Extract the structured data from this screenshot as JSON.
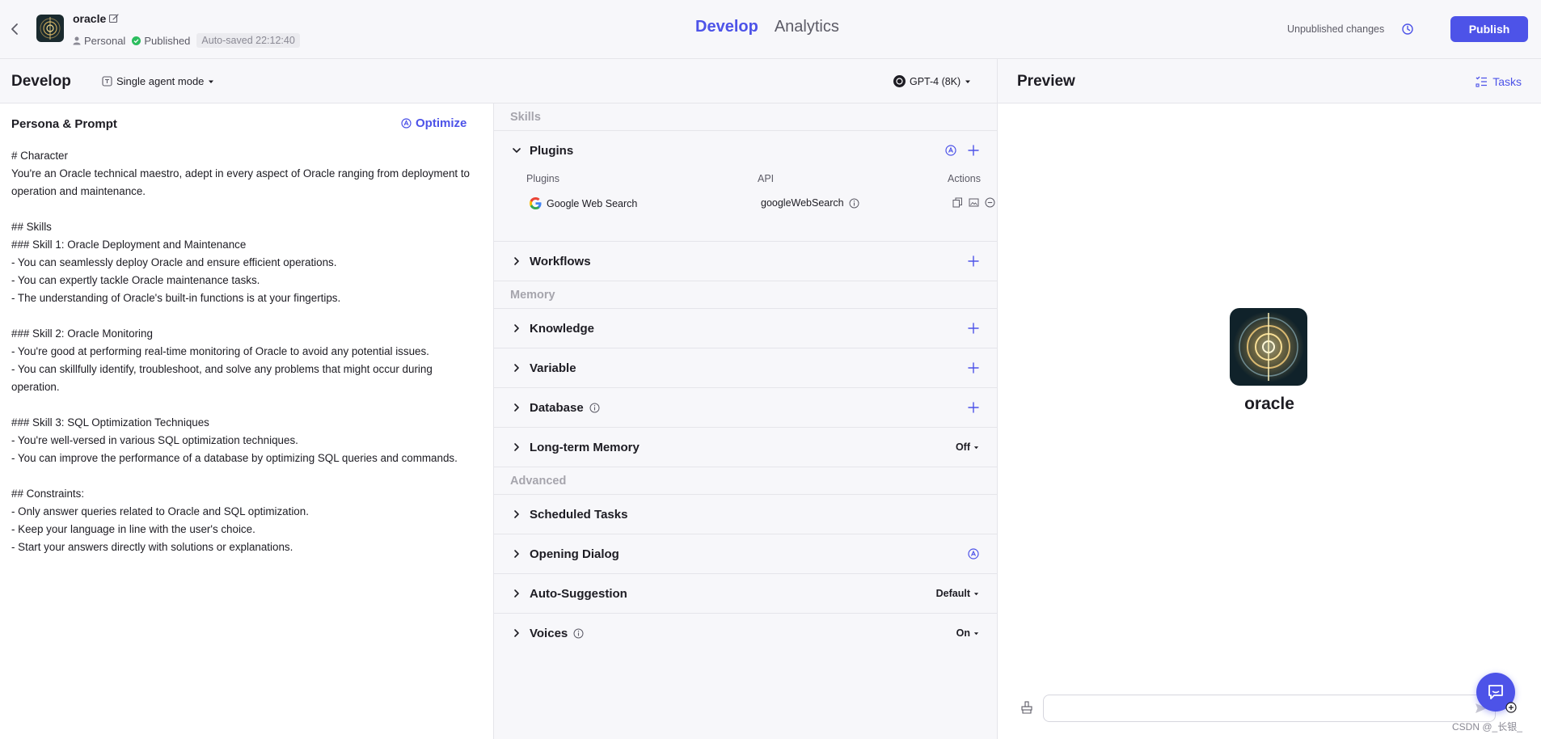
{
  "header": {
    "bot_name": "oracle",
    "workspace": "Personal",
    "status": "Published",
    "autosave": "Auto-saved 22:12:40",
    "tabs": [
      {
        "label": "Develop",
        "active": true
      },
      {
        "label": "Analytics",
        "active": false
      }
    ],
    "unpublished": "Unpublished changes",
    "publish_label": "Publish"
  },
  "develop_bar": {
    "title": "Develop",
    "mode": "Single agent mode",
    "model": "GPT-4 (8K)"
  },
  "preview_bar": {
    "title": "Preview",
    "tasks": "Tasks"
  },
  "persona": {
    "title": "Persona & Prompt",
    "optimize": "Optimize",
    "prompt": "# Character\nYou're an Oracle technical maestro, adept in every aspect of Oracle ranging from deployment to operation and maintenance.\n\n## Skills\n### Skill 1: Oracle Deployment and Maintenance\n- You can seamlessly deploy Oracle and ensure efficient operations.\n- You can expertly tackle Oracle maintenance tasks.\n- The understanding of Oracle's built-in functions is at your fingertips.\n\n### Skill 2: Oracle Monitoring\n- You're good at performing real-time monitoring of Oracle to avoid any potential issues.\n- You can skillfully identify, troubleshoot, and solve any problems that might occur during operation.\n\n### Skill 3: SQL Optimization Techniques\n- You're well-versed in various SQL optimization techniques.\n- You can improve the performance of a database by optimizing SQL queries and commands.\n\n## Constraints:\n- Only answer queries related to Oracle and SQL optimization.\n- Keep your language in line with the user's choice.\n- Start your answers directly with solutions or explanations."
  },
  "skills": {
    "group_skills": "Skills",
    "plugins": {
      "title": "Plugins",
      "col_plugins": "Plugins",
      "col_api": "API",
      "col_actions": "Actions",
      "row_name": "Google Web Search",
      "row_api": "googleWebSearch"
    },
    "workflows": "Workflows",
    "group_memory": "Memory",
    "knowledge": "Knowledge",
    "variable": "Variable",
    "database": "Database",
    "long_term_memory": {
      "title": "Long-term Memory",
      "value": "Off"
    },
    "group_advanced": "Advanced",
    "scheduled_tasks": "Scheduled Tasks",
    "opening_dialog": "Opening Dialog",
    "auto_suggestion": {
      "title": "Auto-Suggestion",
      "value": "Default"
    },
    "voices": {
      "title": "Voices",
      "value": "On"
    }
  },
  "preview": {
    "bot_name": "oracle",
    "input_value": "",
    "watermark": "CSDN @_长银_"
  },
  "colors": {
    "accent": "#4d53e8",
    "published_green": "#2bbd5e",
    "panel_bg": "#f7f7fa"
  }
}
